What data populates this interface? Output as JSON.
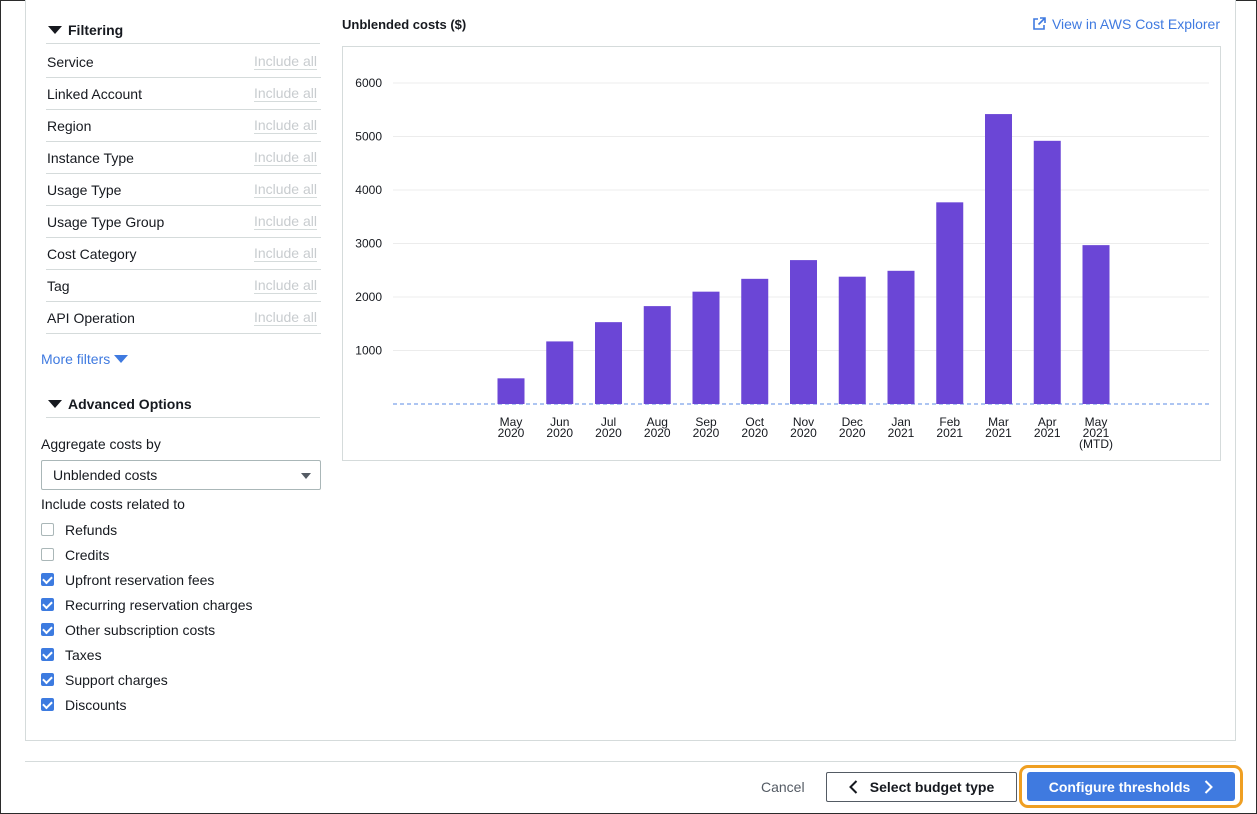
{
  "filtering": {
    "title": "Filtering",
    "rows": [
      {
        "label": "Service",
        "action": "Include all"
      },
      {
        "label": "Linked Account",
        "action": "Include all"
      },
      {
        "label": "Region",
        "action": "Include all"
      },
      {
        "label": "Instance Type",
        "action": "Include all"
      },
      {
        "label": "Usage Type",
        "action": "Include all"
      },
      {
        "label": "Usage Type Group",
        "action": "Include all"
      },
      {
        "label": "Cost Category",
        "action": "Include all"
      },
      {
        "label": "Tag",
        "action": "Include all"
      },
      {
        "label": "API Operation",
        "action": "Include all"
      }
    ],
    "more_filters": "More filters"
  },
  "advanced": {
    "title": "Advanced Options",
    "aggregate_label": "Aggregate costs by",
    "aggregate_value": "Unblended costs",
    "include_label": "Include costs related to",
    "options": [
      {
        "label": "Refunds",
        "checked": false
      },
      {
        "label": "Credits",
        "checked": false
      },
      {
        "label": "Upfront reservation fees",
        "checked": true
      },
      {
        "label": "Recurring reservation charges",
        "checked": true
      },
      {
        "label": "Other subscription costs",
        "checked": true
      },
      {
        "label": "Taxes",
        "checked": true
      },
      {
        "label": "Support charges",
        "checked": true
      },
      {
        "label": "Discounts",
        "checked": true
      }
    ]
  },
  "chart_header": {
    "title": "Unblended costs ($)",
    "link": "View in AWS Cost Explorer"
  },
  "chart_data": {
    "type": "bar",
    "title": "Unblended costs ($)",
    "categories": [
      [
        "May",
        "2020"
      ],
      [
        "Jun",
        "2020"
      ],
      [
        "Jul",
        "2020"
      ],
      [
        "Aug",
        "2020"
      ],
      [
        "Sep",
        "2020"
      ],
      [
        "Oct",
        "2020"
      ],
      [
        "Nov",
        "2020"
      ],
      [
        "Dec",
        "2020"
      ],
      [
        "Jan",
        "2021"
      ],
      [
        "Feb",
        "2021"
      ],
      [
        "Mar",
        "2021"
      ],
      [
        "Apr",
        "2021"
      ],
      [
        "May",
        "2021",
        "(MTD)"
      ]
    ],
    "values": [
      480,
      1170,
      1530,
      1830,
      2100,
      2340,
      2690,
      2380,
      2490,
      3770,
      5420,
      4920,
      2970
    ],
    "yticks": [
      1000,
      2000,
      3000,
      4000,
      5000,
      6000
    ],
    "ylim": [
      0,
      6300
    ],
    "grid": true,
    "bar_color": "#6b46d6"
  },
  "footer": {
    "cancel": "Cancel",
    "previous": "Select budget type",
    "next": "Configure thresholds"
  },
  "colors": {
    "accent": "#3f7ae0",
    "focus_ring": "#ef9f22",
    "bar": "#6b46d6"
  }
}
